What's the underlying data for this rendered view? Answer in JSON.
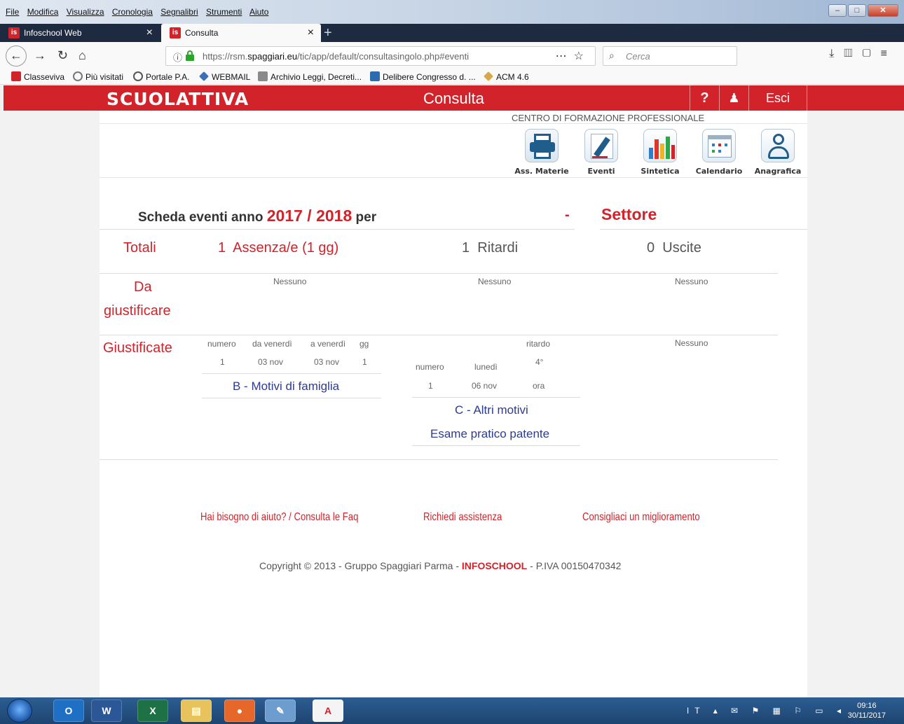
{
  "browser": {
    "menu": [
      "File",
      "Modifica",
      "Visualizza",
      "Cronologia",
      "Segnalibri",
      "Strumenti",
      "Aiuto"
    ],
    "tabs": [
      {
        "label": "Infoschool Web",
        "close": "×"
      },
      {
        "label": "Consulta",
        "close": "×"
      }
    ],
    "new_tab": "+",
    "url_prefix": "https://rsm.",
    "url_domain": "spaggiari.eu",
    "url_path": "/tic/app/default/consultasingolo.php#eventi",
    "search_placeholder": "Cerca",
    "bookmarks": [
      "Classeviva",
      "Più visitati",
      "Portale P.A.",
      "WEBMAIL",
      "Archivio Leggi, Decreti...",
      "Delibere Congresso d. ...",
      "ACM 4.6"
    ]
  },
  "header": {
    "brand": "SCUOLATTIVA",
    "title": "Consulta",
    "help": "?",
    "exit": "Esci",
    "school": "CENTRO DI FORMAZIONE PROFESSIONALE"
  },
  "toolbar": [
    {
      "label": "Ass. Materie",
      "icon": "printer-icon"
    },
    {
      "label": "Eventi",
      "icon": "pen-icon"
    },
    {
      "label": "Sintetica",
      "icon": "bar-chart-icon"
    },
    {
      "label": "Calendario",
      "icon": "calendar-icon"
    },
    {
      "label": "Anagrafica",
      "icon": "person-icon"
    }
  ],
  "scheda": {
    "prefix": "Scheda eventi anno",
    "year": "2017 / 2018",
    "suffix": "per",
    "dash": "-",
    "settore": "Settore"
  },
  "totali": {
    "label": "Totali",
    "assenze_num": "1",
    "assenze_label": "Assenza/e (1 gg)",
    "ritardi_num": "1",
    "ritardi_label": "Ritardi",
    "uscite_num": "0",
    "uscite_label": "Uscite"
  },
  "da_giustificare": {
    "label_line1": "Da",
    "label_line2": "giustificare",
    "col1": "Nessuno",
    "col2": "Nessuno",
    "col3": "Nessuno"
  },
  "giustificate": {
    "label": "Giustificate",
    "assenze": {
      "headers": [
        "numero",
        "da venerdì",
        "a venerdì",
        "gg"
      ],
      "row": [
        "1",
        "03 nov",
        "03 nov",
        "1"
      ],
      "motivo": "B - Motivi di famiglia"
    },
    "ritardi": {
      "header_ritardo": "ritardo",
      "headers": [
        "numero",
        "lunedì",
        "4°"
      ],
      "row": [
        "1",
        "06 nov",
        "ora"
      ],
      "motivo": "C - Altri motivi",
      "nota": "Esame pratico patente"
    },
    "uscite": "Nessuno"
  },
  "footer": {
    "help": "Hai bisogno di aiuto? / Consulta le Faq",
    "assistenza": "Richiedi assistenza",
    "miglioramento": "Consigliaci un miglioramento",
    "copy_prefix": "Copyright © 2013 - Gruppo Spaggiari Parma -",
    "copy_brand": "INFOSCHOOL",
    "copy_suffix": "- P.IVA 00150470342"
  },
  "taskbar": {
    "language": "IT",
    "time": "09:16",
    "date": "30/11/2017"
  },
  "colors": {
    "brand_red": "#d2232a",
    "link_blue": "#2e3c8c"
  }
}
